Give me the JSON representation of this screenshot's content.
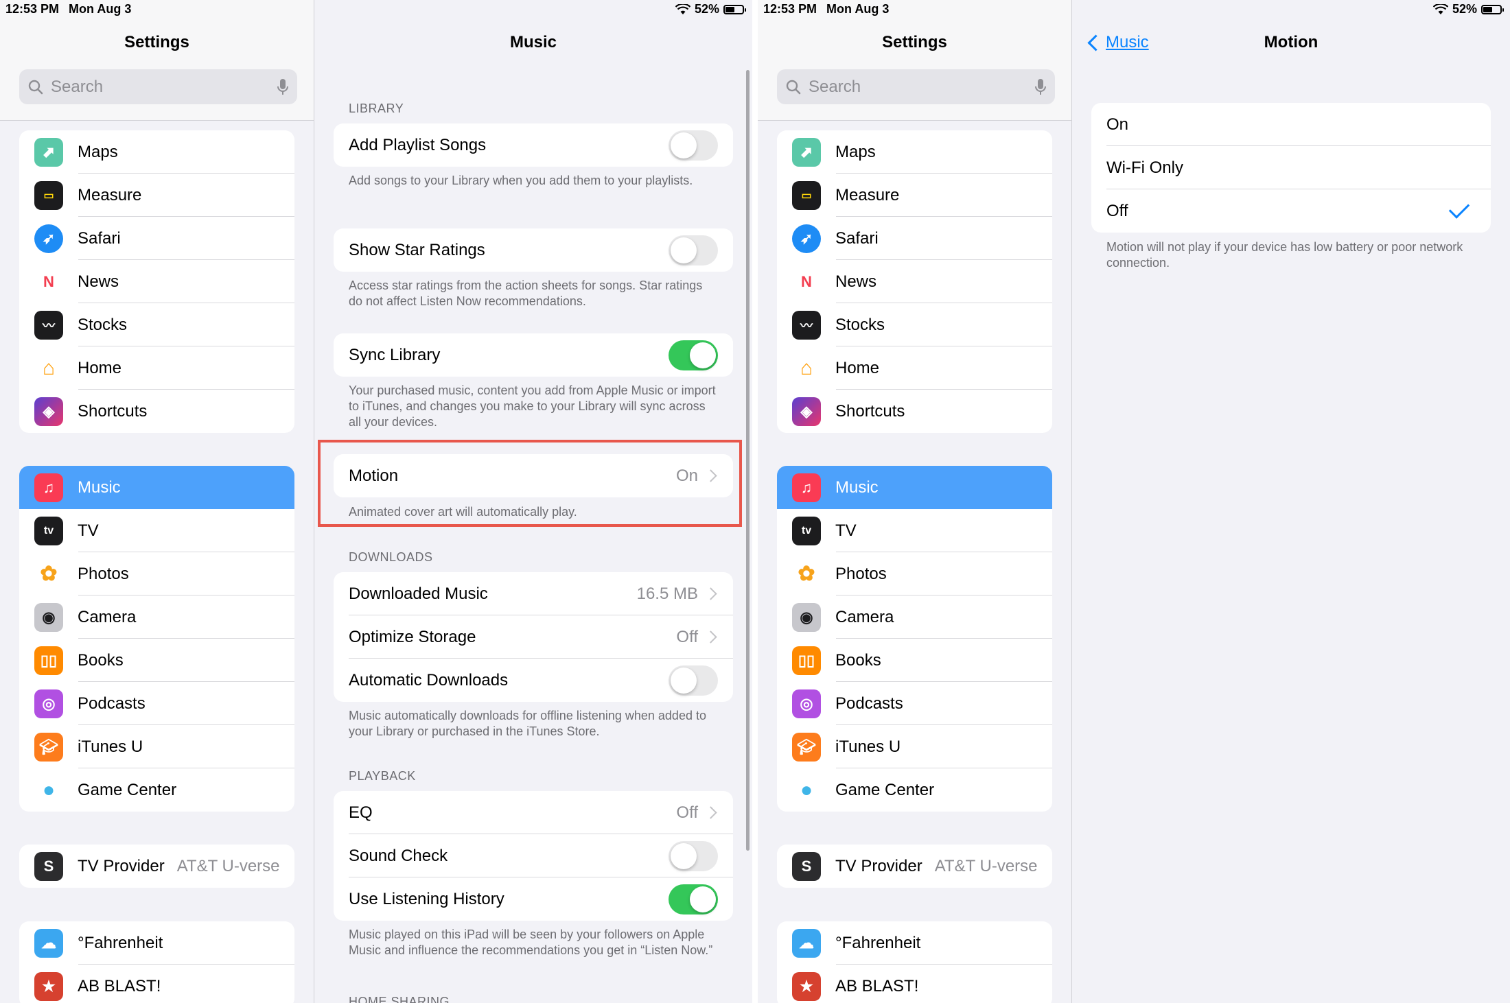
{
  "status": {
    "time": "12:53 PM",
    "date": "Mon Aug 3",
    "battery": "52%"
  },
  "sidebar": {
    "title": "Settings",
    "search_placeholder": "Search",
    "group1": [
      {
        "label": "Maps",
        "icon": "maps-icon",
        "color": "#5ac8a8"
      },
      {
        "label": "Measure",
        "icon": "measure-icon",
        "color": "#1c1c1e"
      },
      {
        "label": "Safari",
        "icon": "safari-icon",
        "color": "#1e8cf5"
      },
      {
        "label": "News",
        "icon": "news-icon",
        "color": "#f33e50"
      },
      {
        "label": "Stocks",
        "icon": "stocks-icon",
        "color": "#1c1c1e"
      },
      {
        "label": "Home",
        "icon": "home-icon",
        "color": "#ff9f0a"
      },
      {
        "label": "Shortcuts",
        "icon": "shortcuts-icon",
        "color": "#5b3fd0"
      }
    ],
    "group2": [
      {
        "label": "Music",
        "icon": "music-icon",
        "color": "#fa3b54",
        "selected": true
      },
      {
        "label": "TV",
        "icon": "tv-icon",
        "color": "#1c1c1e"
      },
      {
        "label": "Photos",
        "icon": "photos-icon",
        "color": "#f7a31b"
      },
      {
        "label": "Camera",
        "icon": "camera-icon",
        "color": "#8e8e93"
      },
      {
        "label": "Books",
        "icon": "books-icon",
        "color": "#ff8a00"
      },
      {
        "label": "Podcasts",
        "icon": "podcasts-icon",
        "color": "#b150e2"
      },
      {
        "label": "iTunes U",
        "icon": "itunes-u-icon",
        "color": "#fd7c1c"
      },
      {
        "label": "Game Center",
        "icon": "game-center-icon",
        "color": "#3fb5e8"
      }
    ],
    "tv_provider": {
      "label": "TV Provider",
      "value": "AT&T U-verse"
    },
    "group4": [
      {
        "label": "°Fahrenheit",
        "icon": "fahrenheit-icon",
        "color": "#3ba7f0"
      },
      {
        "label": "AB BLAST!",
        "icon": "ab-blast-icon",
        "color": "#d6412f"
      }
    ]
  },
  "music": {
    "title": "Music",
    "library_header": "LIBRARY",
    "add_playlist_songs": "Add Playlist Songs",
    "add_playlist_songs_foot": "Add songs to your Library when you add them to your playlists.",
    "show_star_ratings": "Show Star Ratings",
    "show_star_ratings_foot": "Access star ratings from the action sheets for songs. Star ratings do not affect Listen Now recommendations.",
    "sync_library": "Sync Library",
    "sync_library_foot": "Your purchased music, content you add from Apple Music or import to iTunes, and changes you make to your Library will sync across all your devices.",
    "motion": "Motion",
    "motion_value": "On",
    "motion_foot": "Animated cover art will automatically play.",
    "downloads_header": "DOWNLOADS",
    "downloaded_music": "Downloaded Music",
    "downloaded_music_value": "16.5 MB",
    "optimize_storage": "Optimize Storage",
    "optimize_storage_value": "Off",
    "automatic_downloads": "Automatic Downloads",
    "downloads_foot": "Music automatically downloads for offline listening when added to your Library or purchased in the iTunes Store.",
    "playback_header": "PLAYBACK",
    "eq": "EQ",
    "eq_value": "Off",
    "sound_check": "Sound Check",
    "use_listening_history": "Use Listening History",
    "history_foot": "Music played on this iPad will be seen by your followers on Apple Music and influence the recommendations you get in “Listen Now.”",
    "home_sharing_header": "HOME SHARING"
  },
  "motion_page": {
    "back_label": "Music",
    "title": "Motion",
    "options": [
      "On",
      "Wi-Fi Only",
      "Off"
    ],
    "selected": "Off",
    "foot": "Motion will not play if your device has low battery or poor network connection."
  },
  "colors": {
    "accent": "#0a84ff",
    "selected_row": "#4da1fb",
    "toggle_on": "#34c759",
    "highlight": "#e8574c"
  }
}
